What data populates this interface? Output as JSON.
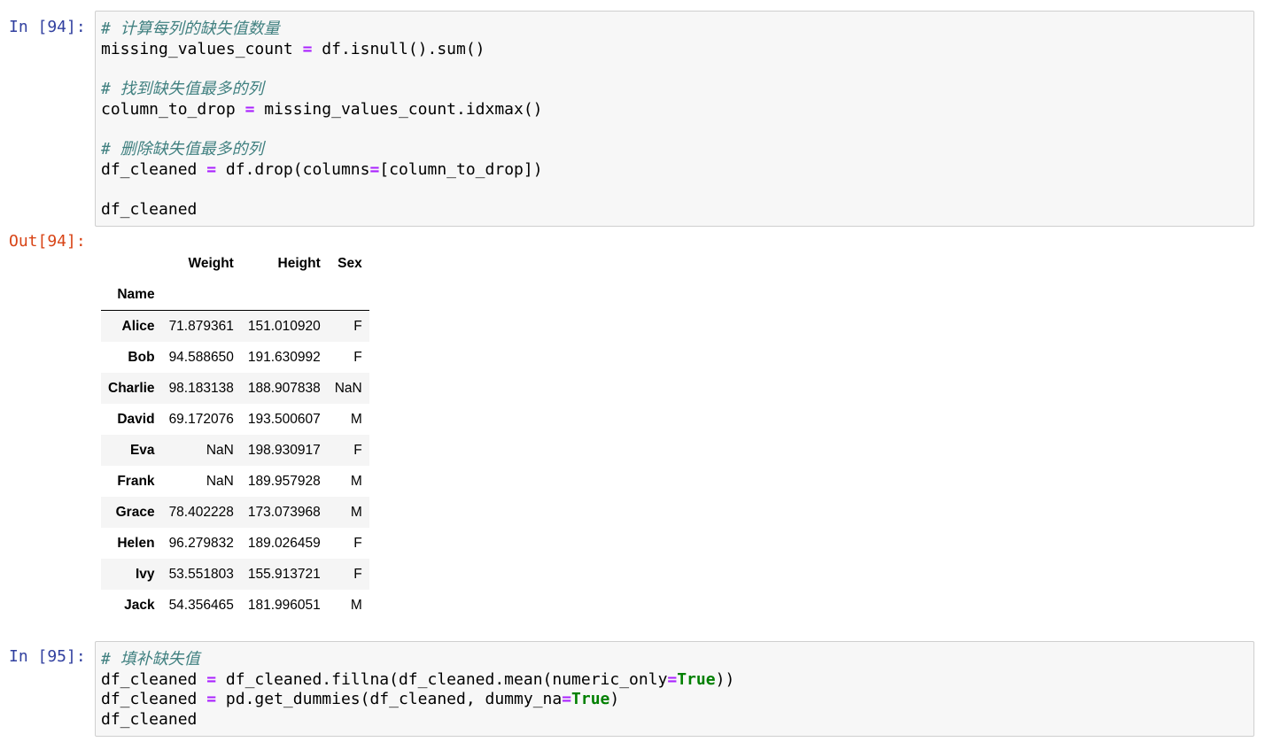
{
  "cell94": {
    "in_prompt": "In [94]:",
    "out_prompt": "Out[94]:",
    "lines": {
      "l1": "# 计算每列的缺失值数量",
      "l2a": "missing_values_count",
      "l2op": "=",
      "l2b": "df.isnull().sum()",
      "l4": "# 找到缺失值最多的列",
      "l5a": "column_to_drop",
      "l5op": "=",
      "l5b": "missing_values_count.idxmax()",
      "l7": "# 删除缺失值最多的列",
      "l8a": "df_cleaned",
      "l8op": "=",
      "l8b": "df.drop(columns",
      "l8op2": "=",
      "l8c": "[column_to_drop])",
      "l10": "df_cleaned"
    },
    "table": {
      "columns": [
        "Weight",
        "Height",
        "Sex"
      ],
      "index_name": "Name",
      "rows": [
        {
          "name": "Alice",
          "weight": "71.879361",
          "height": "151.010920",
          "sex": "F"
        },
        {
          "name": "Bob",
          "weight": "94.588650",
          "height": "191.630992",
          "sex": "F"
        },
        {
          "name": "Charlie",
          "weight": "98.183138",
          "height": "188.907838",
          "sex": "NaN"
        },
        {
          "name": "David",
          "weight": "69.172076",
          "height": "193.500607",
          "sex": "M"
        },
        {
          "name": "Eva",
          "weight": "NaN",
          "height": "198.930917",
          "sex": "F"
        },
        {
          "name": "Frank",
          "weight": "NaN",
          "height": "189.957928",
          "sex": "M"
        },
        {
          "name": "Grace",
          "weight": "78.402228",
          "height": "173.073968",
          "sex": "M"
        },
        {
          "name": "Helen",
          "weight": "96.279832",
          "height": "189.026459",
          "sex": "F"
        },
        {
          "name": "Ivy",
          "weight": "53.551803",
          "height": "155.913721",
          "sex": "F"
        },
        {
          "name": "Jack",
          "weight": "54.356465",
          "height": "181.996051",
          "sex": "M"
        }
      ]
    }
  },
  "cell95": {
    "in_prompt": "In [95]:",
    "lines": {
      "l1": "# 填补缺失值",
      "l2a": "df_cleaned",
      "l2op": "=",
      "l2b": "df_cleaned.fillna(df_cleaned.mean(numeric_only",
      "l2op2": "=",
      "l2kw": "True",
      "l2c": "))",
      "l3a": "df_cleaned",
      "l3op": "=",
      "l3b": "pd.get_dummies(df_cleaned, dummy_na",
      "l3op2": "=",
      "l3kw": "True",
      "l3c": ")",
      "l4": "df_cleaned"
    }
  },
  "colors": {
    "in_prompt": "#303f9f",
    "out_prompt": "#d84315",
    "comment": "#408080",
    "operator": "#aa22ff",
    "keyword": "#008000",
    "cell_bg": "#f7f7f7",
    "cell_border": "#cfcfcf"
  }
}
